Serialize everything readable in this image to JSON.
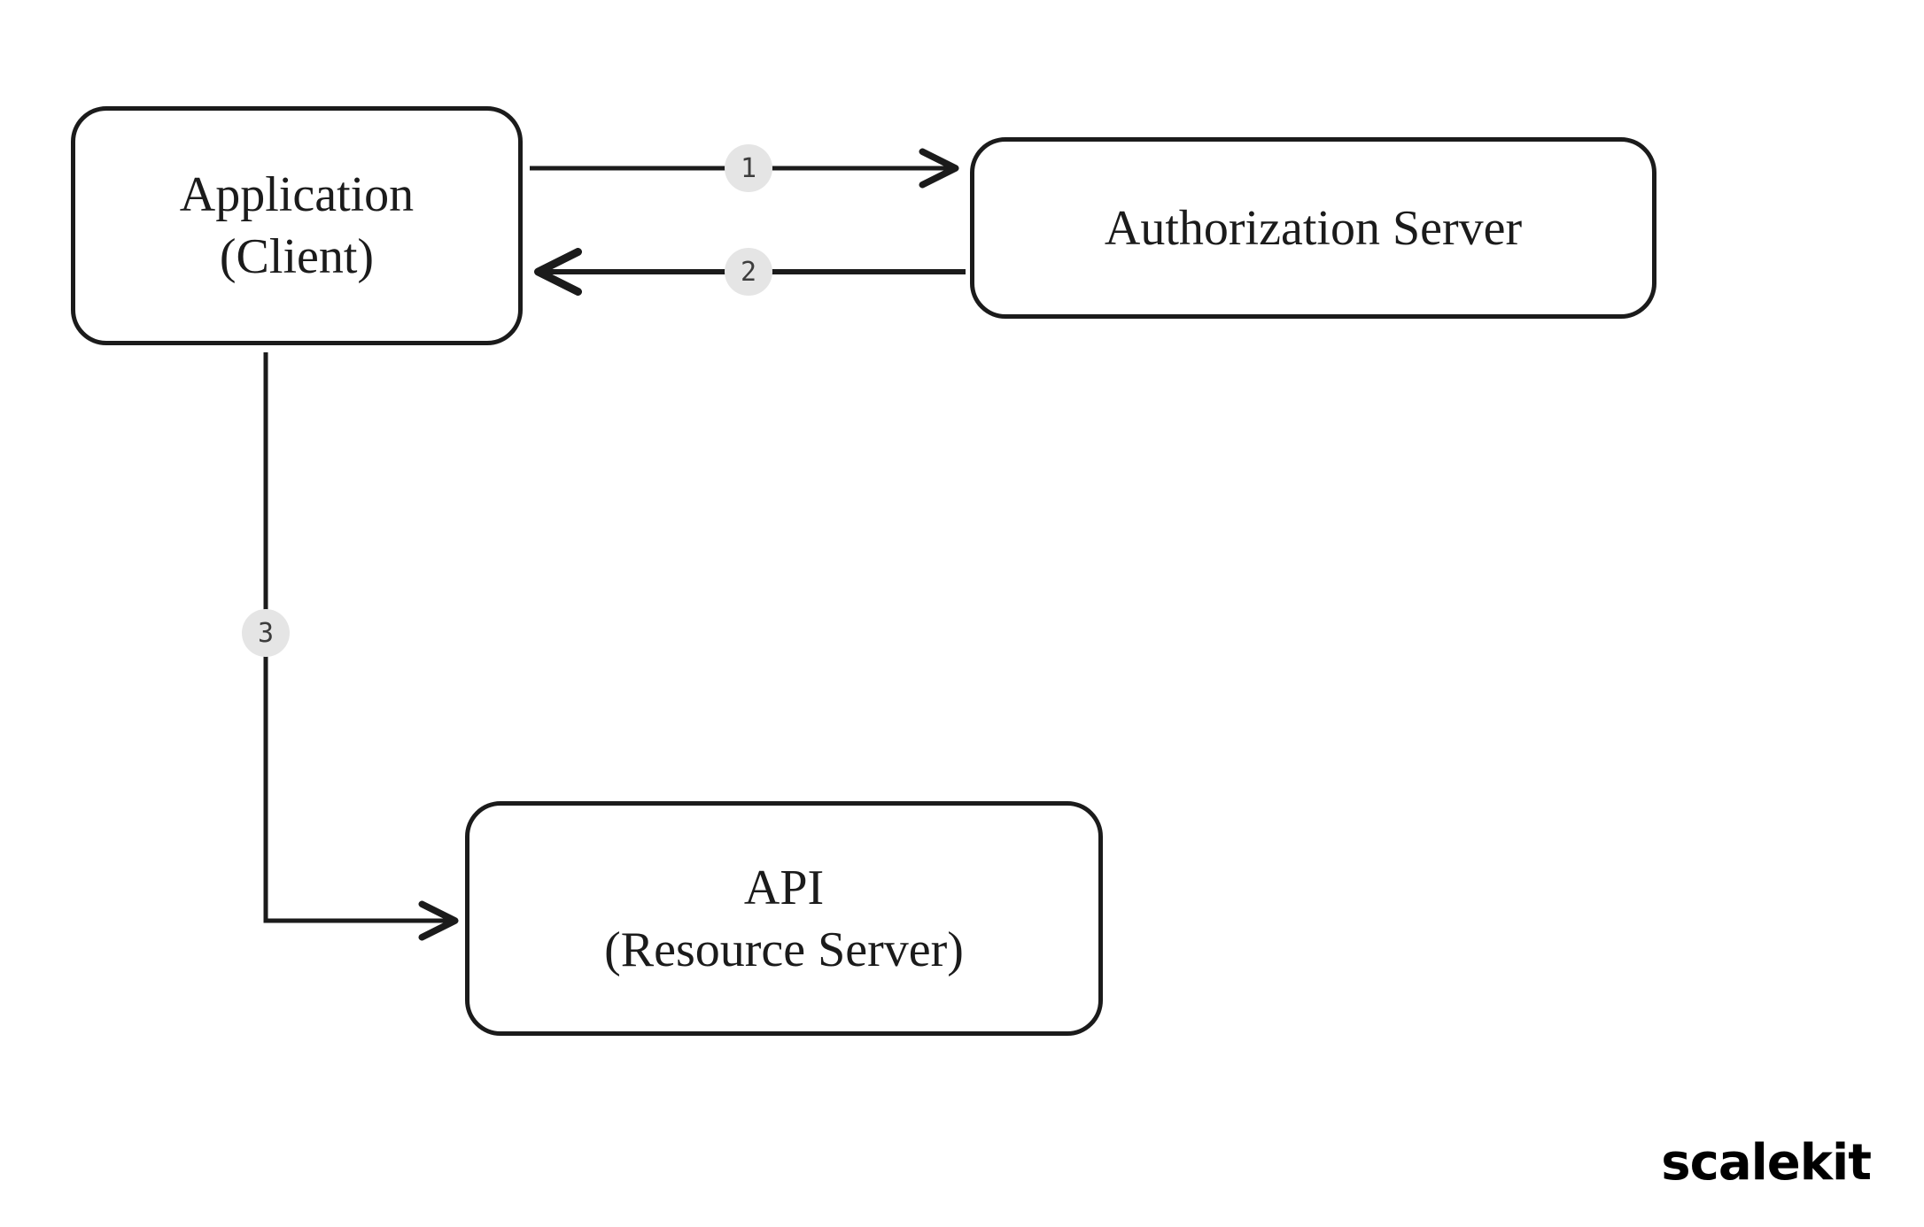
{
  "nodes": {
    "client": {
      "line1": "Application",
      "line2": "(Client)"
    },
    "auth": {
      "label": "Authorization Server"
    },
    "api": {
      "line1": "API",
      "line2": "(Resource Server)"
    }
  },
  "edges": {
    "step1": "1",
    "step2": "2",
    "step3": "3"
  },
  "brand": "scalekit"
}
